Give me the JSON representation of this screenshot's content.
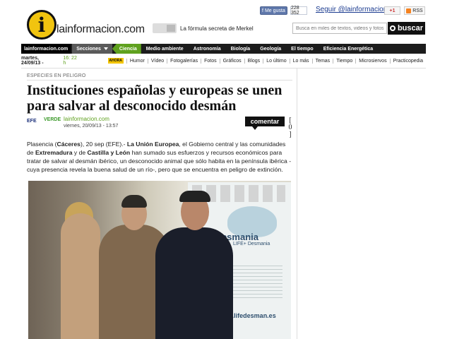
{
  "social": {
    "fb_like": "Me gusta",
    "fb_count": "228 352",
    "follow": "Seguir @lainformacion",
    "gplus": "+1",
    "rss": "RSS"
  },
  "header": {
    "logo_glyph": "i",
    "logo_text": "lainformacion.com",
    "promo": "La fórmula secreta de Merkel",
    "search_placeholder": "Busca en miles de textos, videos y fotos",
    "search_button": "buscar"
  },
  "nav": {
    "home": "lainformacion.com",
    "sections": "Secciones",
    "active": "Ciencia",
    "items": [
      "Medio ambiente",
      "Astronomía",
      "Biología",
      "Geología",
      "El tiempo",
      "Eficiencia Energética"
    ]
  },
  "subbar": {
    "date": "martes, 24/09/13 -",
    "time": "16: 22 h",
    "badge": "AHORA",
    "items": [
      "Humor",
      "Vídeo",
      "Fotogalerías",
      "Fotos",
      "Gráficos",
      "Blogs",
      "Lo último",
      "Lo más",
      "Temas",
      "Tiempo",
      "Microsiervos",
      "Practicopedia"
    ]
  },
  "article": {
    "kicker": "ESPECIES EN PELIGRO",
    "headline": "Instituciones españolas y europeas se unen para salvar al desconocido desmán",
    "source_logo": "EFE",
    "source_sub": "VERDE",
    "byline": "lainformacion.com",
    "date": "viernes, 20/09/13 - 13:57",
    "comment_button": "comentar",
    "comment_count": "[ 0 ]",
    "body": {
      "p1": "Plasencia (",
      "b1": "Cáceres",
      "p2": "), 20 sep (EFE).- ",
      "b2": "La Unión Europea",
      "p3": ", el Gobierno central y las comunidades de ",
      "b3": "Extremadura",
      "p4": " y de ",
      "b4": "Castilla y León",
      "p5": " han sumado sus esfuerzos y recursos económicos para tratar de salvar al desmán ibérico, un desconocido animal que sólo habita en la península ibérica -cuya presencia revela la buena salud de un río-, pero que se encuentra en peligro de extinción."
    },
    "photo": {
      "banner_title": "desmania",
      "banner_sub": "LIFE+ Desmania",
      "banner_url": "www.lifedesman.es"
    }
  }
}
